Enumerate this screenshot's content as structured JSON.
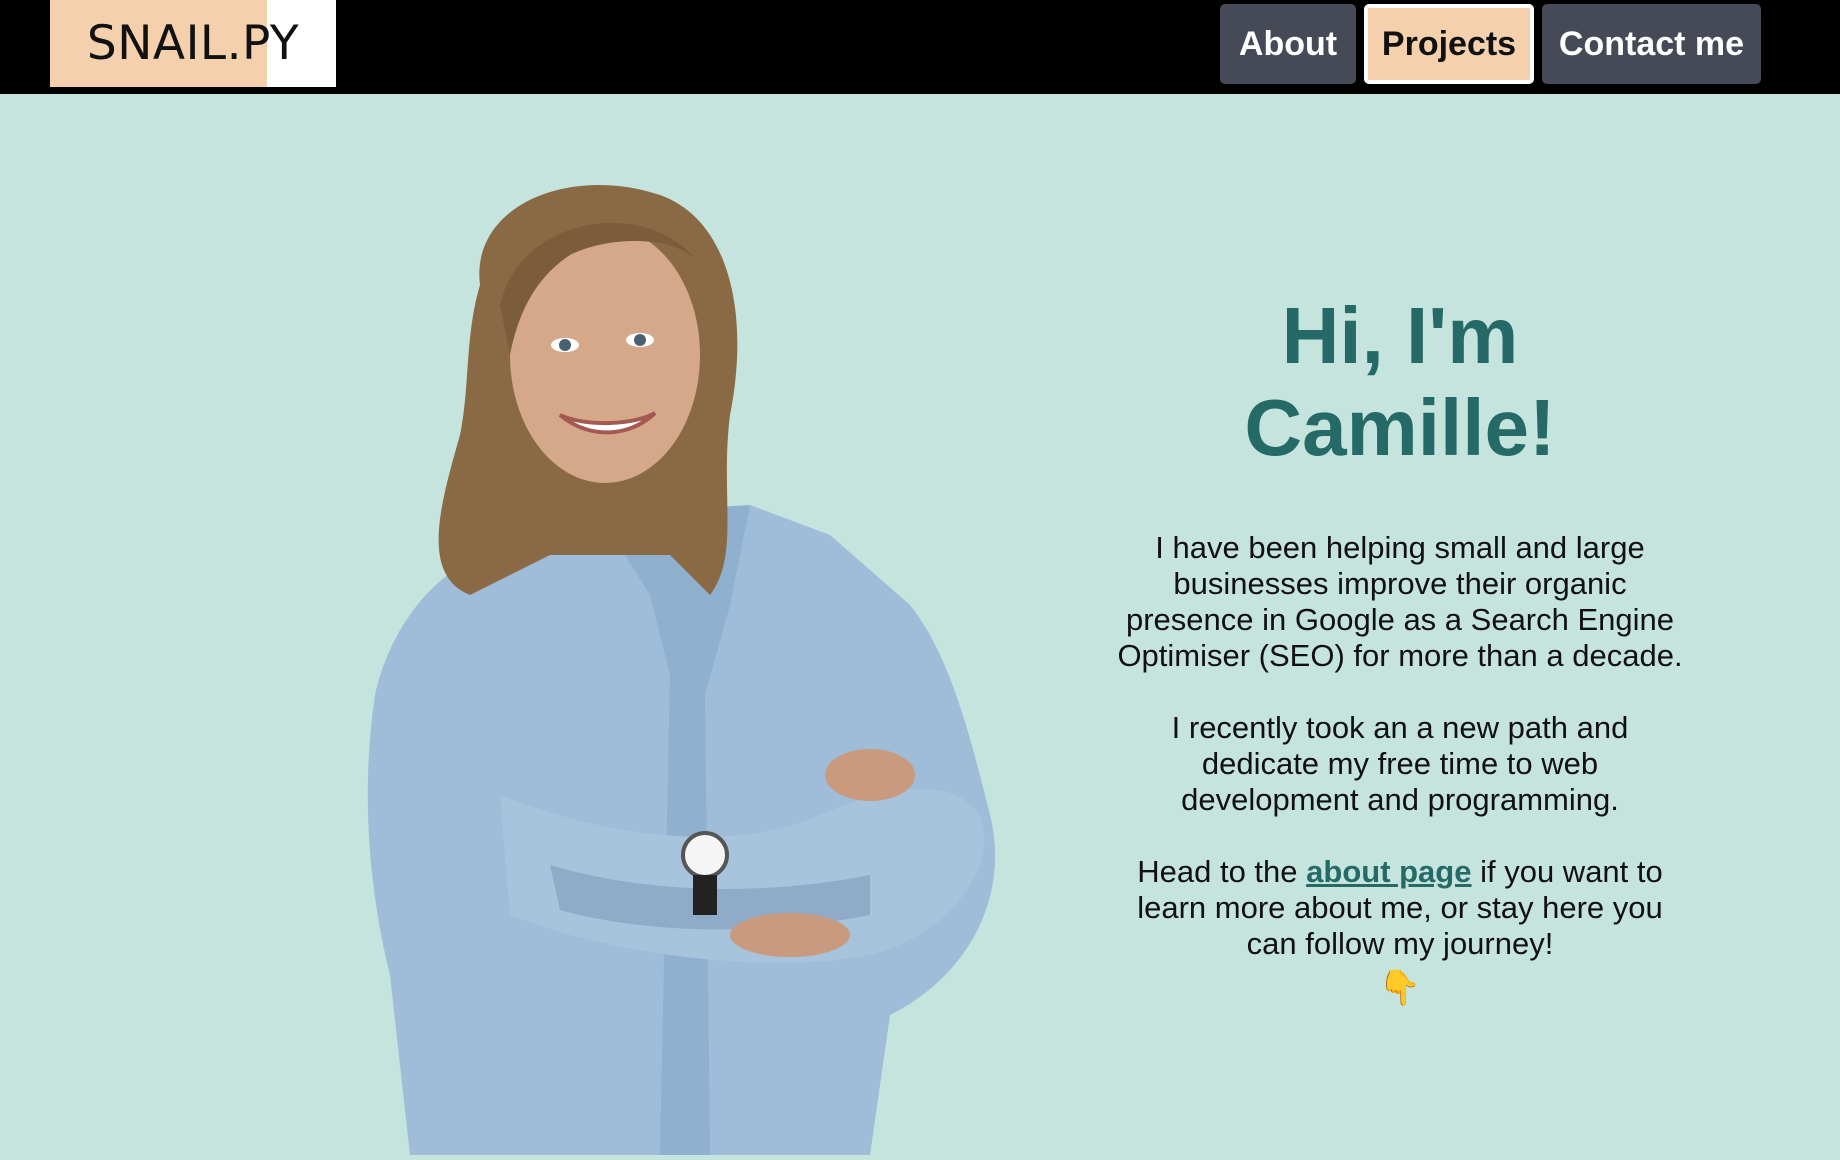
{
  "logo": {
    "text": "SNAIL.PY"
  },
  "nav": {
    "about": "About",
    "projects": "Projects",
    "contact": "Contact me"
  },
  "hero": {
    "title_line1": "Hi, I'm",
    "title_line2": "Camille!",
    "paragraph1": "I have been helping small and large businesses improve their organic presence in Google as a Search Engine Optimiser (SEO) for more than a decade.",
    "paragraph2": "I recently took an a new path and dedicate my free time to web development and programming.",
    "paragraph3_before": "Head to the ",
    "paragraph3_link": "about page",
    "paragraph3_after": " if you want to learn more about me, or stay here you can follow my journey!",
    "pointer_emoji": "👇"
  },
  "colors": {
    "page_background": "#c5e4de",
    "topbar": "#000000",
    "accent_peach": "#f4d0ad",
    "nav_button": "#464a57",
    "heading_teal": "#256a66"
  },
  "icons": {
    "pointer": "backhand-index-pointing-down"
  }
}
